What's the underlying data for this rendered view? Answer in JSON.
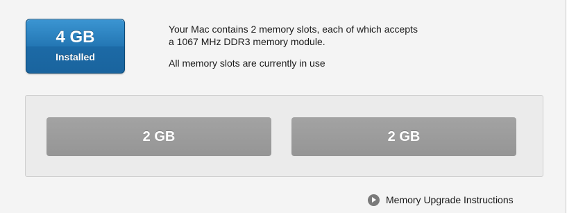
{
  "memory_summary": {
    "installed_size": "4 GB",
    "installed_label": "Installed",
    "badge_color": "#1f6fac"
  },
  "description": {
    "line1": "Your Mac contains 2 memory slots, each of which accepts",
    "line2": "a 1067 MHz DDR3 memory module.",
    "status": "All memory slots are currently in use"
  },
  "slots": [
    {
      "label": "2 GB"
    },
    {
      "label": "2 GB"
    }
  ],
  "upgrade_link": {
    "label": "Memory Upgrade Instructions",
    "icon": "arrow-circle-icon"
  }
}
